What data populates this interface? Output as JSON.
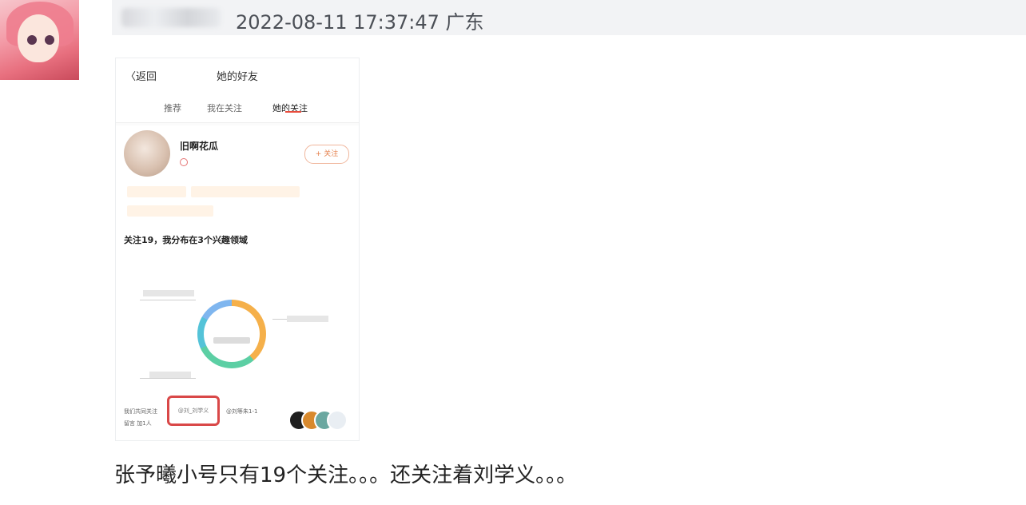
{
  "post": {
    "timestamp_location": "2022-08-11 17:37:47 广东",
    "caption": "张予曦小号只有19个关注。。。还关注着刘学义。。。"
  },
  "screenshot": {
    "back_label": "〈返回",
    "title": "她的好友",
    "tabs": [
      "推荐",
      "我在关注",
      "她的关注"
    ],
    "profile_name": "旧啊花瓜",
    "follow_label": "+ 关注",
    "section_title": "关注19，我分布在3个兴趣领域",
    "mention": "@刘_刘学义",
    "bottom_left": "我们共同关注",
    "bottom_left_2": "留言 加1人",
    "bottom_right": "@刘等朱1-1"
  },
  "colors": {
    "header_bg": "#f2f3f5",
    "highlight_box": "#d94848",
    "tab_accent": "#e84b3c"
  }
}
